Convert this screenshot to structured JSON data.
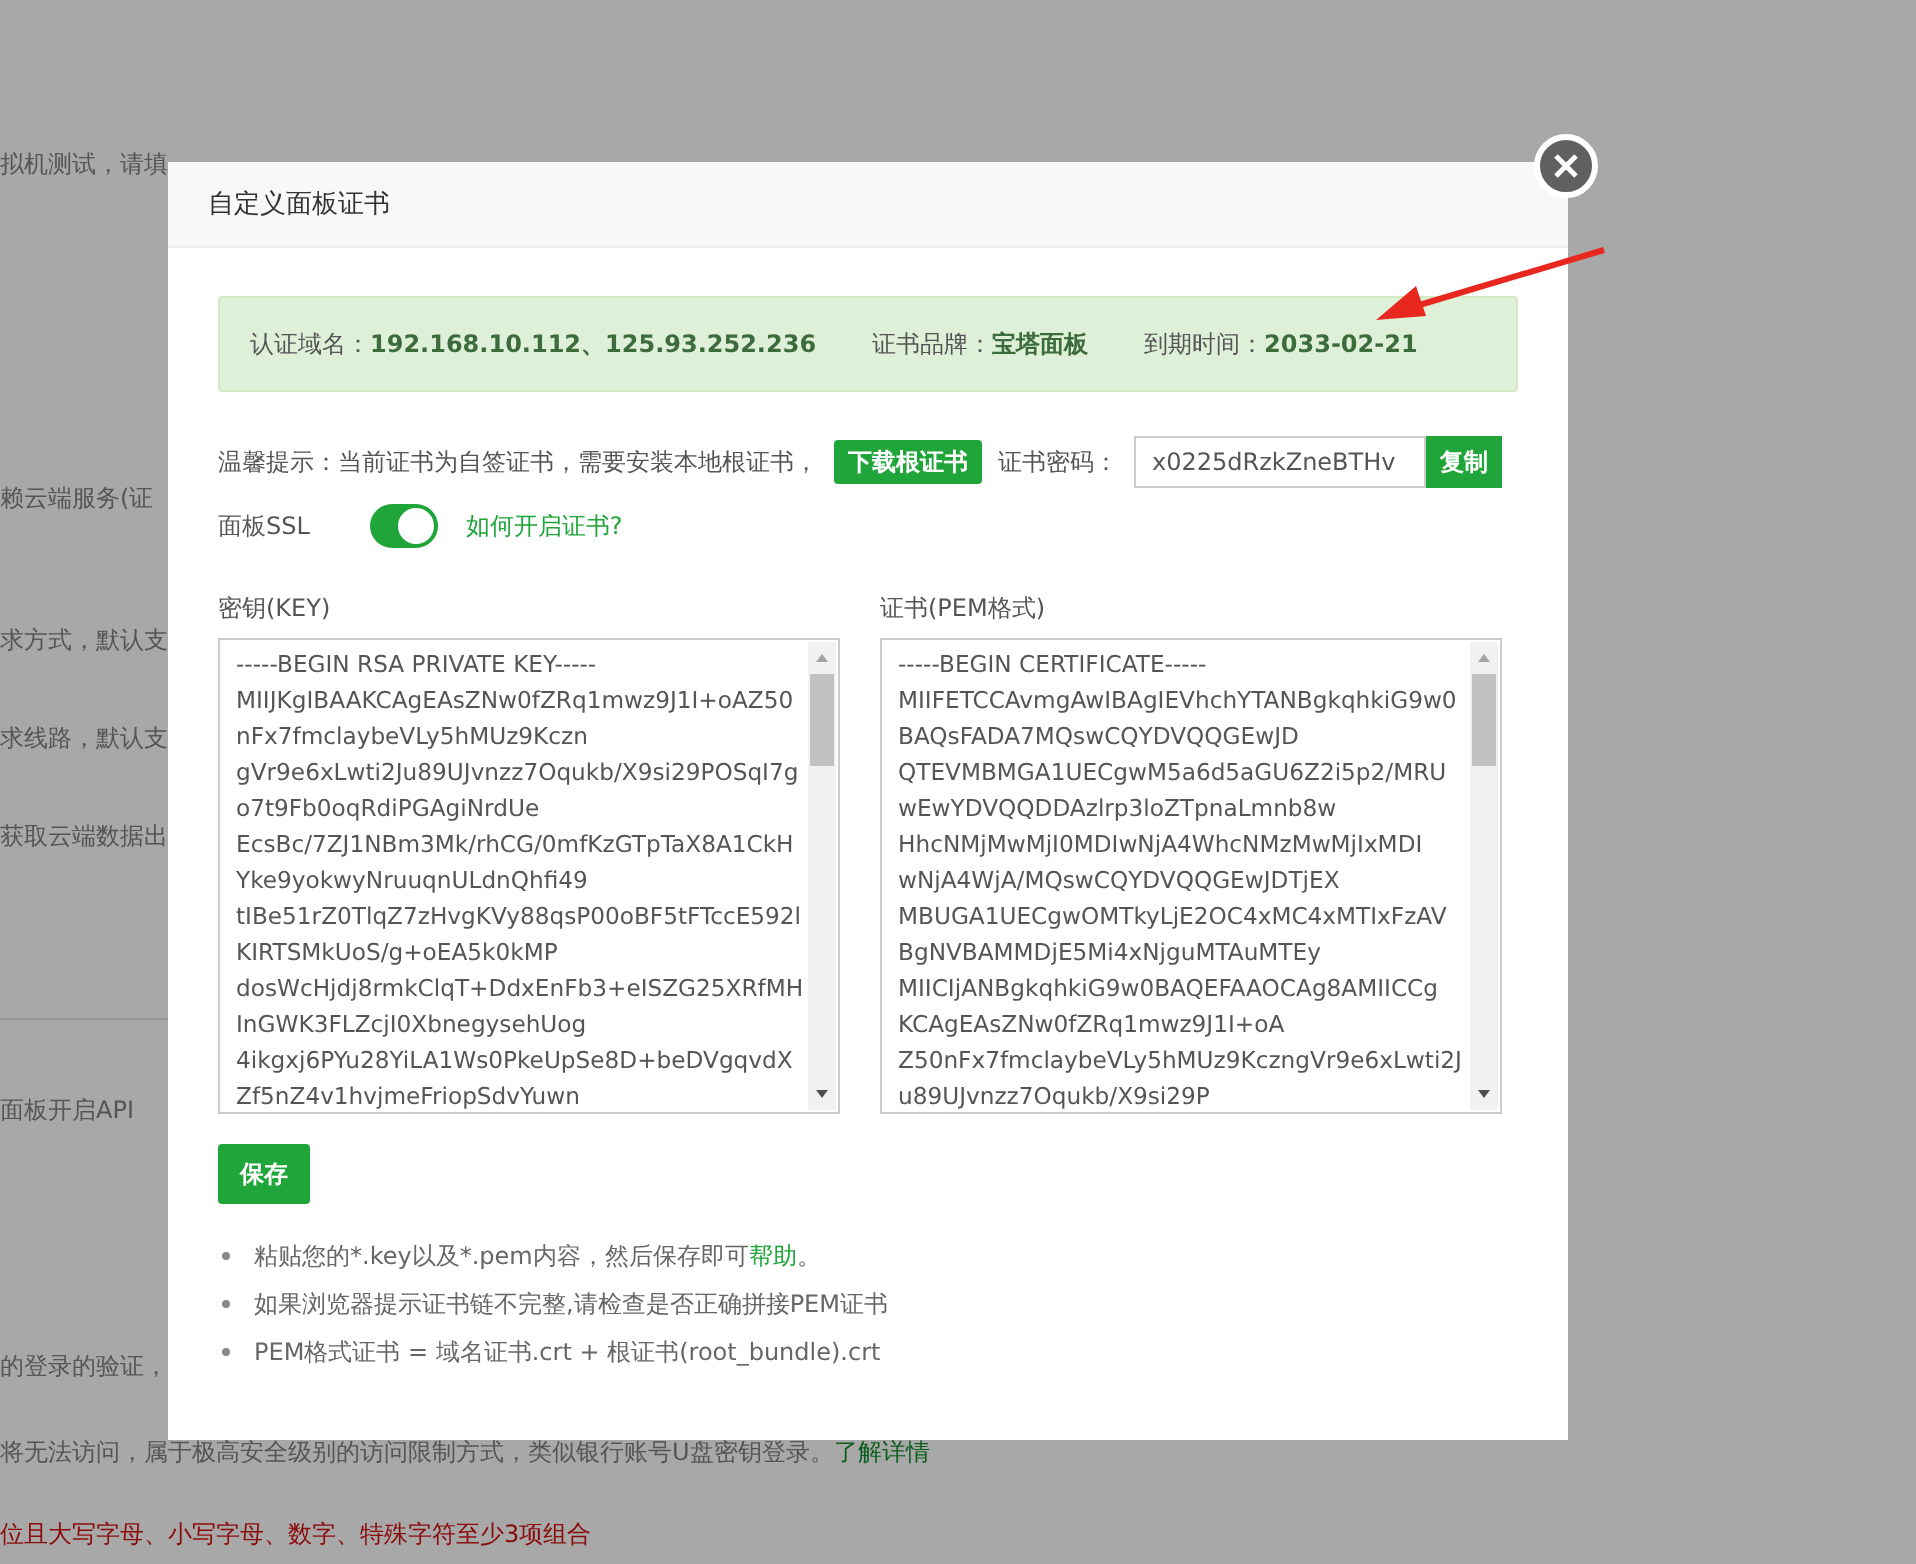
{
  "background_page": {
    "lines": [
      {
        "kind": "plain",
        "text": "拟机测试，请填"
      },
      {
        "kind": "plain",
        "text": "赖云端服务(证"
      },
      {
        "kind": "plain",
        "text": "求方式，默认支"
      },
      {
        "kind": "plain",
        "text": "求线路，默认支"
      },
      {
        "kind": "plain",
        "text": "获取云端数据出"
      },
      {
        "kind": "plain",
        "text": "面板开启API"
      },
      {
        "kind": "plain",
        "text": "的登录的验证，"
      },
      {
        "kind": "link",
        "text": "将无法访问，属于极高安全级别的访问限制方式，类似银行账号U盘密钥登录。",
        "link": "了解详情"
      },
      {
        "kind": "warning",
        "text": "位且大写字母、小写字母、数字、特殊字符至少3项组合"
      }
    ]
  },
  "dialog": {
    "title": "自定义面板证书",
    "info": [
      {
        "label": "认证域名：",
        "value": "192.168.10.112、125.93.252.236"
      },
      {
        "label": "证书品牌：",
        "value": "宝塔面板"
      },
      {
        "label": "到期时间：",
        "value": "2033-02-21"
      }
    ],
    "hint": "温馨提示：当前证书为自签证书，需要安装本地根证书，",
    "download_button": "下载根证书",
    "password_label": "证书密码：",
    "password_value": "x0225dRzkZneBTHv",
    "copy_button": "复制",
    "ssl": {
      "label": "面板SSL",
      "on": true,
      "link": "如何开启证书?"
    },
    "key": {
      "label": "密钥(KEY)",
      "lines": [
        "-----BEGIN RSA PRIVATE KEY-----",
        "MIIJKgIBAAKCAgEAsZNw0fZRq1mwz9J1I+oAZ50",
        "nFx7fmclaybeVLy5hMUz9Kczn",
        "gVr9e6xLwti2Ju89UJvnzz7Oqukb/X9si29POSqI7g",
        "o7t9Fb0oqRdiPGAgiNrdUe",
        "EcsBc/7ZJ1NBm3Mk/rhCG/0mfKzGTpTaX8A1CkH",
        "Yke9yokwyNruuqnULdnQhfi49",
        "tIBe51rZ0TlqZ7zHvgKVy88qsP00oBF5tFTccE592l",
        "KIRTSMkUoS/g+oEA5k0kMP",
        "dosWcHjdj8rmkClqT+DdxEnFb3+eISZG25XRfMH",
        "InGWK3FLZcjI0XbnegysehUog",
        "4ikgxj6PYu28YiLA1Ws0PkeUpSe8D+beDVgqvdX",
        "Zf5nZ4v1hvjmeFriopSdvYuwn"
      ]
    },
    "cert": {
      "label": "证书(PEM格式)",
      "lines": [
        "-----BEGIN CERTIFICATE-----",
        "MIIFETCCAvmgAwIBAgIEVhchYTANBgkqhkiG9w0",
        "BAQsFADA7MQswCQYDVQQGEwJD",
        "QTEVMBMGA1UECgwM5a6d5aGU6Z2i5p2/MRU",
        "wEwYDVQQDDAzlrp3loZTpnaLmnb8w",
        "HhcNMjMwMjI0MDIwNjA4WhcNMzMwMjIxMDI",
        "wNjA4WjA/MQswCQYDVQQGEwJDTjEX",
        "MBUGA1UECgwOMTkyLjE2OC4xMC4xMTIxFzAV",
        "BgNVBAMMDjE5Mi4xNjguMTAuMTEy",
        "MIICIjANBgkqhkiG9w0BAQEFAAOCAg8AMIICCg",
        "KCAgEAsZNw0fZRq1mwz9J1I+oA",
        "Z50nFx7fmclaybeVLy5hMUz9KczngVr9e6xLwti2J",
        "u89UJvnzz7Oqukb/X9si29P"
      ]
    },
    "save_button": "保存",
    "notes": [
      {
        "text": "粘贴您的*.key以及*.pem内容，然后保存即可",
        "link": "帮助",
        "after": "。"
      },
      {
        "text": "如果浏览器提示证书链不完整,请检查是否正确拼接PEM证书"
      },
      {
        "text": "PEM格式证书 = 域名证书.crt + 根证书(root_bundle).crt"
      }
    ]
  }
}
